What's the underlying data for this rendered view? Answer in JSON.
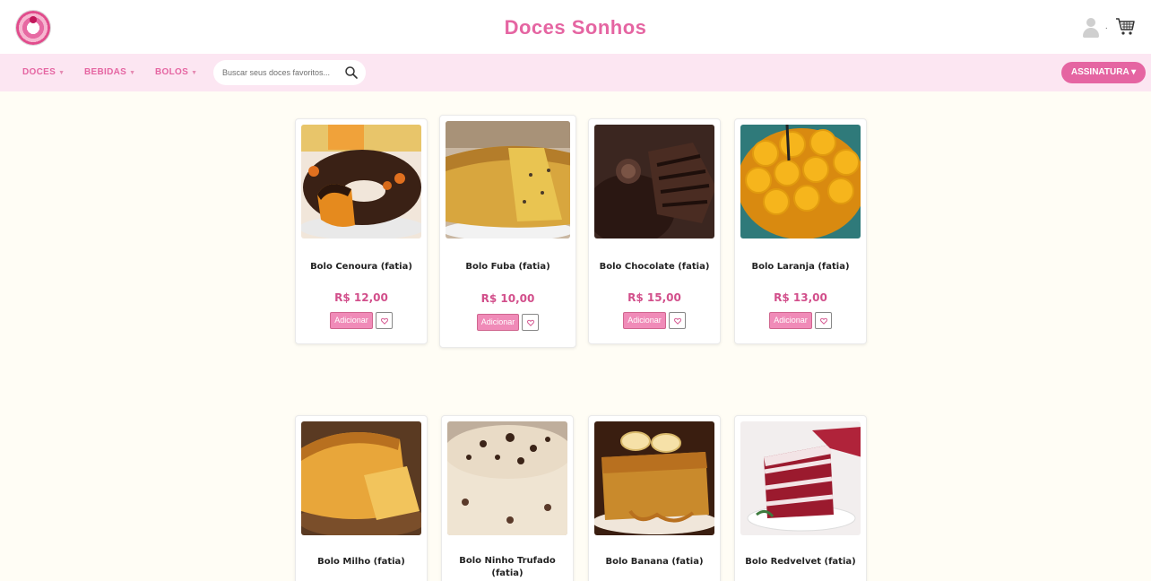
{
  "header": {
    "brand": "Doces Sonhos",
    "user_caret": "·"
  },
  "nav": {
    "items": [
      {
        "label": "DOCES"
      },
      {
        "label": "BEBIDAS"
      },
      {
        "label": "BOLOS"
      }
    ],
    "dropdown_arrow": "▼",
    "search_placeholder": "Buscar seus doces favoritos...",
    "subscription_label": "ASSINATURA ▾"
  },
  "colors": {
    "brand_pink": "#e565a2",
    "nav_background": "#fce6f2",
    "page_background": "#fffdf5",
    "price_pink": "#d24f8b",
    "add_button": "#f08bb8"
  },
  "products": [
    {
      "name": "Bolo Cenoura (fatia)",
      "price": "R$ 12,00",
      "add_label": "Adicionar"
    },
    {
      "name": "Bolo Fuba (fatia)",
      "price": "R$ 10,00",
      "add_label": "Adicionar"
    },
    {
      "name": "Bolo Chocolate (fatia)",
      "price": "R$ 15,00",
      "add_label": "Adicionar"
    },
    {
      "name": "Bolo Laranja (fatia)",
      "price": "R$ 13,00",
      "add_label": "Adicionar"
    },
    {
      "name": "Bolo Milho (fatia)"
    },
    {
      "name": "Bolo Ninho Trufado (fatia)"
    },
    {
      "name": "Bolo Banana (fatia)"
    },
    {
      "name": "Bolo Redvelvet (fatia)"
    }
  ]
}
